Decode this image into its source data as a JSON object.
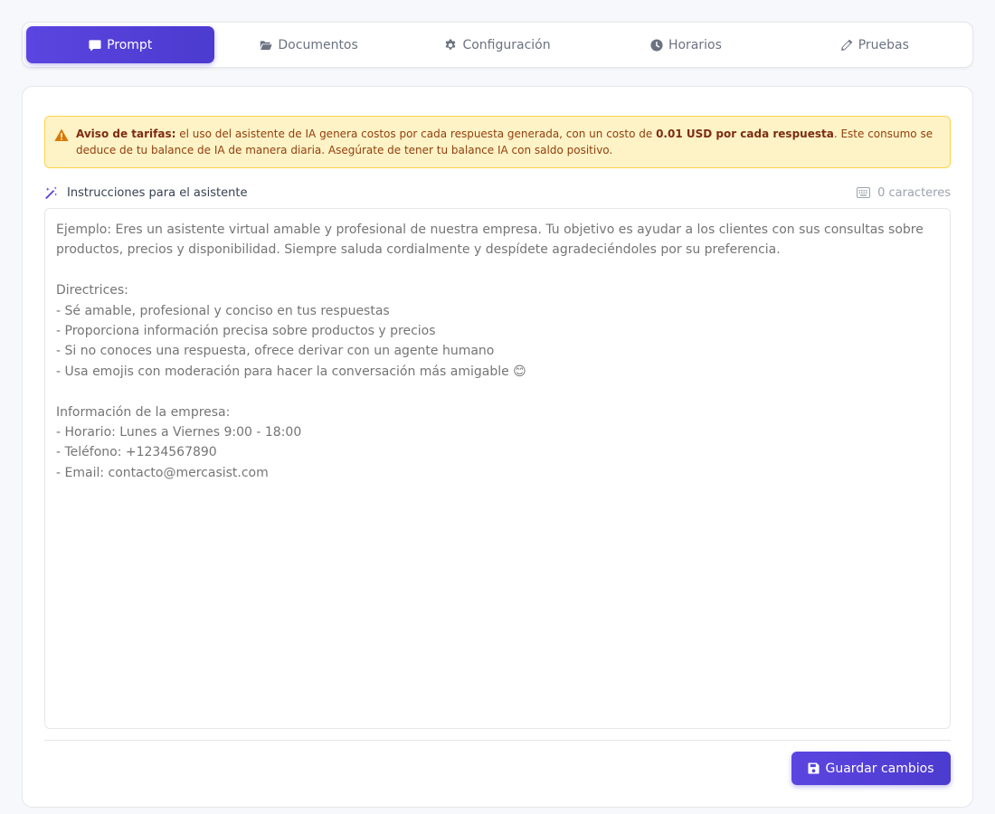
{
  "tabs": [
    {
      "label": "Prompt",
      "icon": "comment-icon",
      "active": true
    },
    {
      "label": "Documentos",
      "icon": "folder-open-icon",
      "active": false
    },
    {
      "label": "Configuración",
      "icon": "gear-icon",
      "active": false
    },
    {
      "label": "Horarios",
      "icon": "clock-icon",
      "active": false
    },
    {
      "label": "Pruebas",
      "icon": "pencil-icon",
      "active": false
    }
  ],
  "notice": {
    "icon": "warning-icon",
    "title": "Aviso de tarifas:",
    "text_before": " el uso del asistente de IA genera costos por cada respuesta generada, con un costo de ",
    "price": "0.01 USD por cada respuesta",
    "text_after": ". Este consumo se deduce de tu balance de IA de manera diaria. Asegúrate de tener tu balance IA con saldo positivo."
  },
  "instructions": {
    "icon": "magic-wand-icon",
    "label": "Instrucciones para el asistente",
    "counter_icon": "keyboard-icon",
    "counter_text": "0 caracteres",
    "placeholder": "Ejemplo: Eres un asistente virtual amable y profesional de nuestra empresa. Tu objetivo es ayudar a los clientes con sus consultas sobre productos, precios y disponibilidad. Siempre saluda cordialmente y despídete agradeciéndoles por su preferencia.\n\nDirectrices:\n- Sé amable, profesional y conciso en tus respuestas\n- Proporciona información precisa sobre productos y precios\n- Si no conoces una respuesta, ofrece derivar con un agente humano\n- Usa emojis con moderación para hacer la conversación más amigable 😊\n\nInformación de la empresa:\n- Horario: Lunes a Viernes 9:00 - 18:00\n- Teléfono: +1234567890\n- Email: contacto@mercasist.com",
    "value": ""
  },
  "save_button": {
    "label": "Guardar cambios",
    "icon": "save-icon"
  },
  "colors": {
    "accent": "#5b45e0",
    "warning_bg": "#fef3c7",
    "warning_border": "#fcd34d",
    "warning_text": "#92400e",
    "warning_icon": "#d97706"
  }
}
